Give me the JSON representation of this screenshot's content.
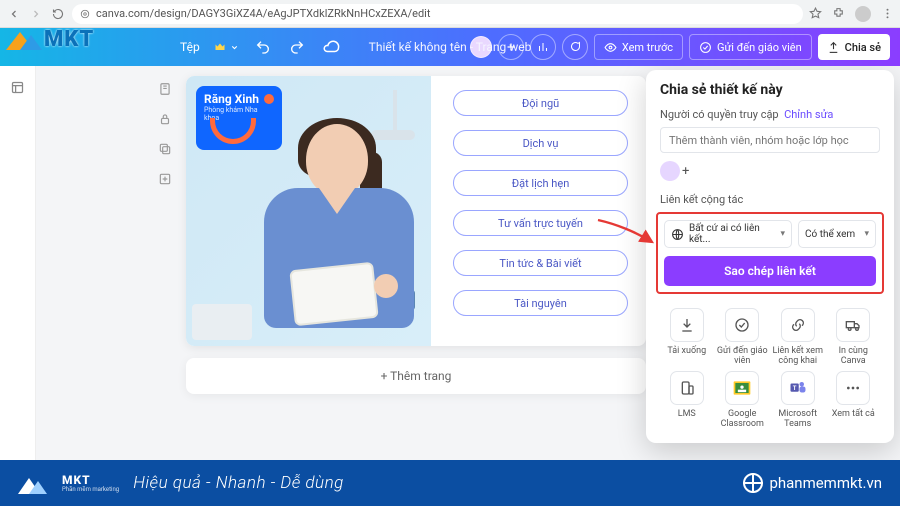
{
  "browser": {
    "url": "canva.com/design/DAGY3GiXZ4A/eAgJPTXdklZRkNnHCxZEXA/edit"
  },
  "toolbar": {
    "menu_file": "Tệp",
    "design_title": "Thiết kế không tên - Trang web",
    "preview": "Xem trước",
    "send_teacher": "Gửi đến giáo viên",
    "share": "Chia sẻ"
  },
  "canvas": {
    "badge_title": "Răng Xinh",
    "badge_sub": "Phòng khám Nha khoa",
    "buttons": [
      "Đội ngũ",
      "Dịch vụ",
      "Đặt lịch hẹn",
      "Tư vấn trực tuyến",
      "Tin tức & Bài viết",
      "Tài nguyên"
    ],
    "add_page": "+ Thêm trang"
  },
  "share_panel": {
    "title": "Chia sẻ thiết kế này",
    "access_label": "Người có quyền truy cập",
    "edit_link": "Chỉnh sửa",
    "member_placeholder": "Thêm thành viên, nhóm hoặc lớp học",
    "collab_label": "Liên kết cộng tác",
    "link_scope": "Bất cứ ai có liên kết...",
    "link_perm": "Có thể xem",
    "copy_btn": "Sao chép liên kết",
    "grid_row1": [
      {
        "icon": "download",
        "label": "Tải xuống"
      },
      {
        "icon": "teacher",
        "label": "Gửi đến giáo viên"
      },
      {
        "icon": "publiclink",
        "label": "Liên kết xem công khai"
      },
      {
        "icon": "print",
        "label": "In cùng Canva"
      }
    ],
    "grid_row2": [
      {
        "icon": "lms",
        "label": "LMS"
      },
      {
        "icon": "gclass",
        "label": "Google Classroom"
      },
      {
        "icon": "teams",
        "label": "Microsoft Teams"
      },
      {
        "icon": "more",
        "label": "Xem tất cả"
      }
    ]
  },
  "footer": {
    "brand": "MKT",
    "brand_sub": "Phần mềm marketing",
    "tagline": "Hiệu quả - Nhanh  - Dễ dùng",
    "site": "phanmemmkt.vn"
  },
  "colors": {
    "accent": "#8b3dff",
    "highlight_border": "#e53935",
    "footer_bg": "#0b4ea2"
  }
}
